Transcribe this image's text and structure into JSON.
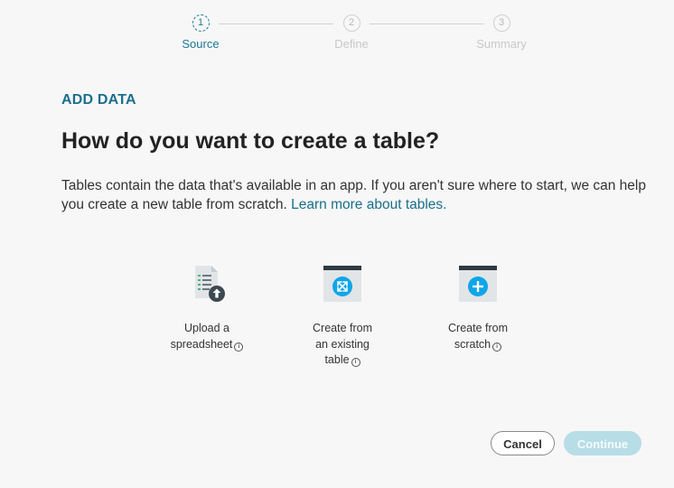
{
  "stepper": {
    "steps": [
      {
        "number": "1",
        "label": "Source",
        "active": true
      },
      {
        "number": "2",
        "label": "Define",
        "active": false
      },
      {
        "number": "3",
        "label": "Summary",
        "active": false
      }
    ]
  },
  "header": {
    "eyebrow": "ADD DATA",
    "title": "How do you want to create a table?",
    "description": "Tables contain the data that's available in an app. If you aren't sure where to start, we can help you create a new table from scratch.",
    "learn_more_link": "Learn more about tables."
  },
  "options": [
    {
      "line1": "Upload a",
      "line2": "spreadsheet",
      "line3": "",
      "icon": "upload-spreadsheet-icon"
    },
    {
      "line1": "Create from",
      "line2": "an existing",
      "line3": "table",
      "icon": "existing-table-icon"
    },
    {
      "line1": "Create from",
      "line2": "scratch",
      "line3": "",
      "icon": "new-table-icon"
    }
  ],
  "info_icon_glyph": "i",
  "footer": {
    "cancel_label": "Cancel",
    "continue_label": "Continue",
    "continue_disabled": true
  },
  "colors": {
    "accent": "#1a6f8c",
    "icon_blue": "#0ea5e9",
    "header_dark": "#2f3a40",
    "continue_disabled_bg": "#b7dde6"
  }
}
